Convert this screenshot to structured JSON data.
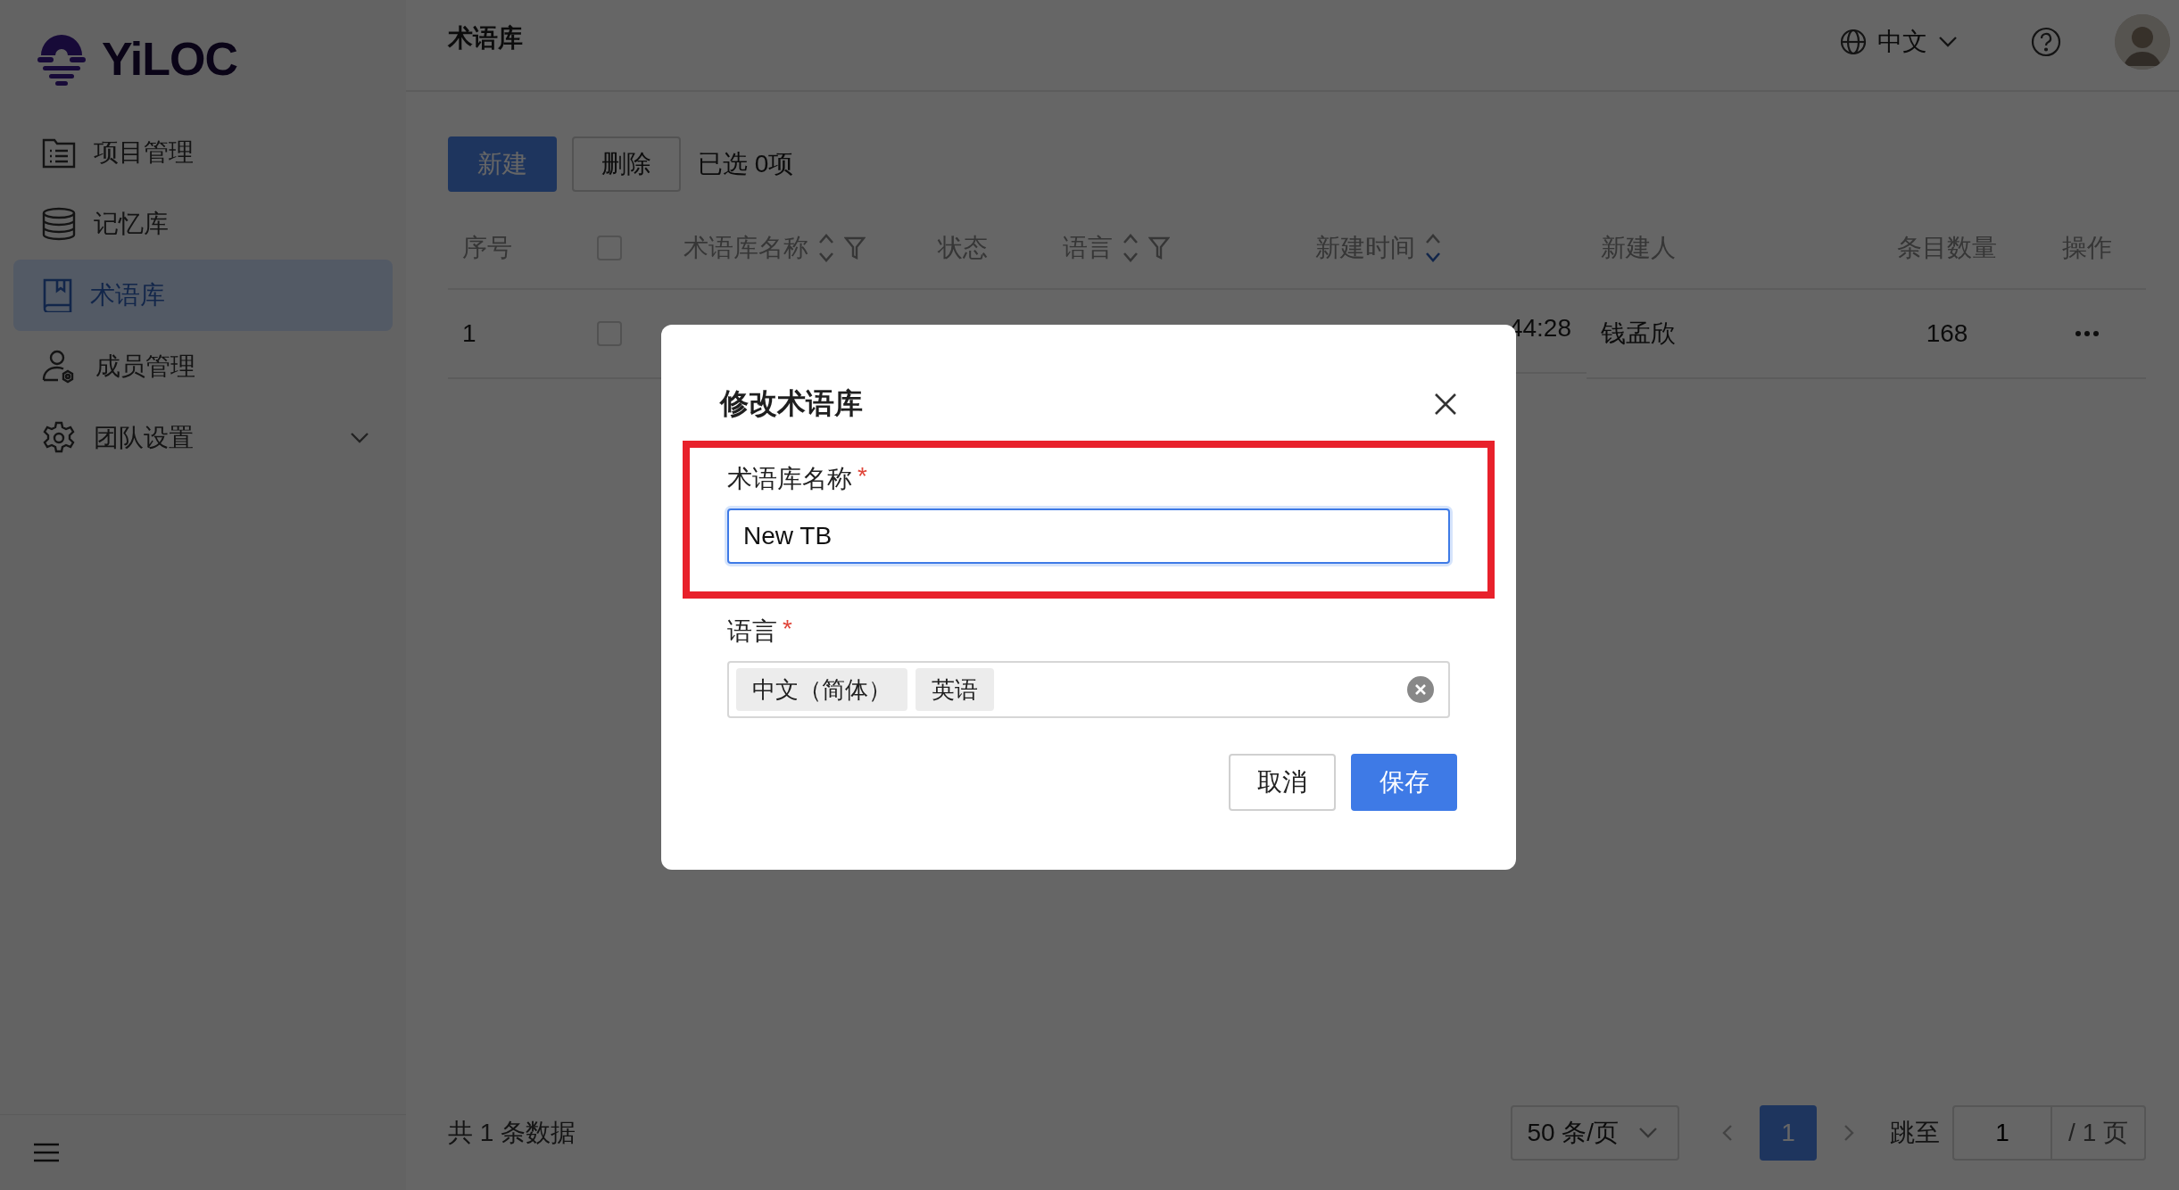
{
  "logo": {
    "text": "YiLOC"
  },
  "sidebar": {
    "items": [
      {
        "label": "项目管理",
        "selected": false,
        "expandable": false
      },
      {
        "label": "记忆库",
        "selected": false,
        "expandable": false
      },
      {
        "label": "术语库",
        "selected": true,
        "expandable": false
      },
      {
        "label": "成员管理",
        "selected": false,
        "expandable": false
      },
      {
        "label": "团队设置",
        "selected": false,
        "expandable": true
      }
    ]
  },
  "header": {
    "title": "术语库",
    "language": "中文"
  },
  "toolbar": {
    "buttons": [
      {
        "label": "新建",
        "kind": "primary"
      },
      {
        "label": "删除",
        "kind": "secondary"
      }
    ],
    "selection": "已选 0项"
  },
  "table": {
    "select_all_checked": false,
    "columns": [
      {
        "label": "序号",
        "sortable": false,
        "filterable": false
      },
      {
        "label": "术语库名称",
        "sortable": true,
        "sorted_desc": false,
        "filterable": true
      },
      {
        "label": "状态",
        "sortable": false,
        "filterable": false
      },
      {
        "label": "语言",
        "sortable": true,
        "sorted_desc": false,
        "filterable": true
      },
      {
        "label": "新建时间",
        "sortable": true,
        "sorted_desc": true,
        "filterable": false
      },
      {
        "label": "新建人",
        "sortable": false,
        "filterable": false
      },
      {
        "label": "条目数量",
        "sortable": false,
        "filterable": false
      },
      {
        "label": "操作",
        "sortable": false,
        "filterable": false
      }
    ],
    "rows": [
      {
        "checked": false,
        "index": "1",
        "created": "44:28",
        "creator": "钱孟欣",
        "count": "168"
      }
    ]
  },
  "footer": {
    "total": "共 1 条数据",
    "page_size": "50 条/页",
    "pages": [
      {
        "label": "1",
        "selected": true
      }
    ],
    "jump_label": "跳至",
    "jump_value": "1",
    "page_total": "/ 1 页"
  },
  "dialog": {
    "title": "修改术语库",
    "fields": [
      {
        "kind": "text",
        "label": "术语库名称",
        "required_mark": "*",
        "value": "New TB",
        "focused": true,
        "highlighted": true
      },
      {
        "kind": "tags",
        "label": "语言",
        "required_mark": "*",
        "tags": [
          "中文（简体）",
          "英语"
        ],
        "highlighted": false
      }
    ],
    "buttons": [
      {
        "label": "取消",
        "kind": "secondary"
      },
      {
        "label": "保存",
        "kind": "primary"
      }
    ]
  }
}
